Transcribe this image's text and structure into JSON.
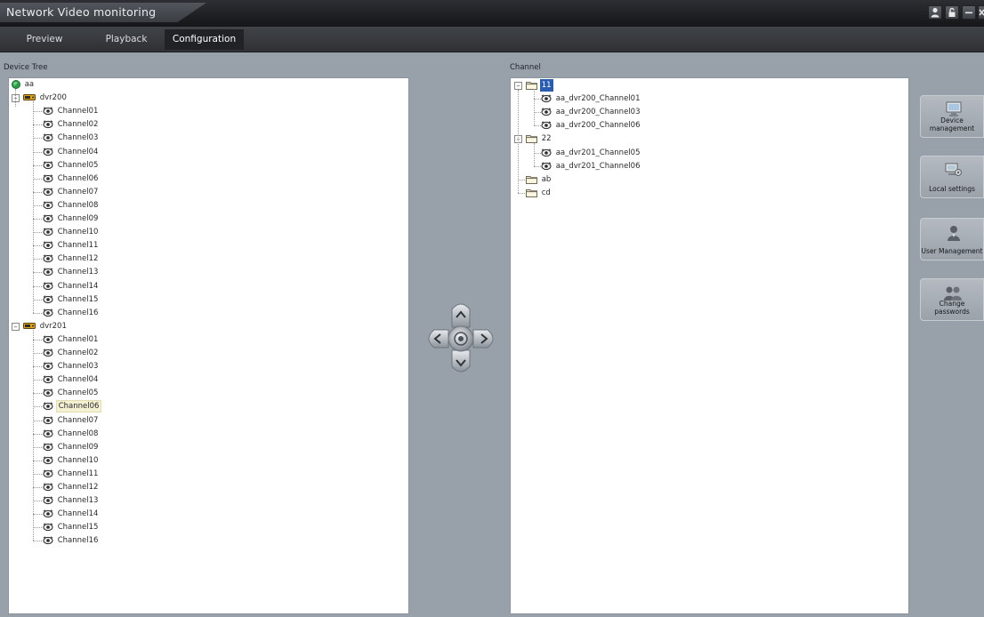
{
  "window": {
    "title": "Network Video monitoring",
    "controls": [
      "user-icon",
      "lock-icon",
      "minimize-icon",
      "close-icon"
    ]
  },
  "menu": {
    "tabs": [
      {
        "label": "Preview",
        "active": false
      },
      {
        "label": "Playback",
        "active": false
      },
      {
        "label": "Configuration",
        "active": true
      }
    ]
  },
  "device_tree": {
    "label": "Device Tree",
    "root": "aa",
    "devices": [
      {
        "name": "dvr200",
        "channels": [
          "Channel01",
          "Channel02",
          "Channel03",
          "Channel04",
          "Channel05",
          "Channel06",
          "Channel07",
          "Channel08",
          "Channel09",
          "Channel10",
          "Channel11",
          "Channel12",
          "Channel13",
          "Channel14",
          "Channel15",
          "Channel16"
        ]
      },
      {
        "name": "dvr201",
        "highlighted": "Channel06",
        "channels": [
          "Channel01",
          "Channel02",
          "Channel03",
          "Channel04",
          "Channel05",
          "Channel06",
          "Channel07",
          "Channel08",
          "Channel09",
          "Channel10",
          "Channel11",
          "Channel12",
          "Channel13",
          "Channel14",
          "Channel15",
          "Channel16"
        ]
      }
    ]
  },
  "channel_tree": {
    "label": "Channel",
    "groups": [
      {
        "name": "11",
        "selected": true,
        "items": [
          "aa_dvr200_Channel01",
          "aa_dvr200_Channel03",
          "aa_dvr200_Channel06"
        ]
      },
      {
        "name": "22",
        "selected": false,
        "items": [
          "aa_dvr201_Channel05",
          "aa_dvr201_Channel06"
        ]
      },
      {
        "name": "ab",
        "selected": false,
        "items": []
      },
      {
        "name": "cd",
        "selected": false,
        "items": []
      }
    ]
  },
  "side_menu": {
    "buttons": [
      {
        "label": "Device management",
        "icon": "monitor-icon"
      },
      {
        "label": "Local settings",
        "icon": "computer-settings-icon"
      },
      {
        "label": "User Management",
        "icon": "user-icon"
      },
      {
        "label": "Change passwords",
        "icon": "users-icon"
      }
    ]
  },
  "ptz": {
    "buttons": [
      "up-arrow-icon",
      "down-arrow-icon",
      "left-arrow-icon",
      "right-arrow-icon",
      "center-icon"
    ]
  }
}
